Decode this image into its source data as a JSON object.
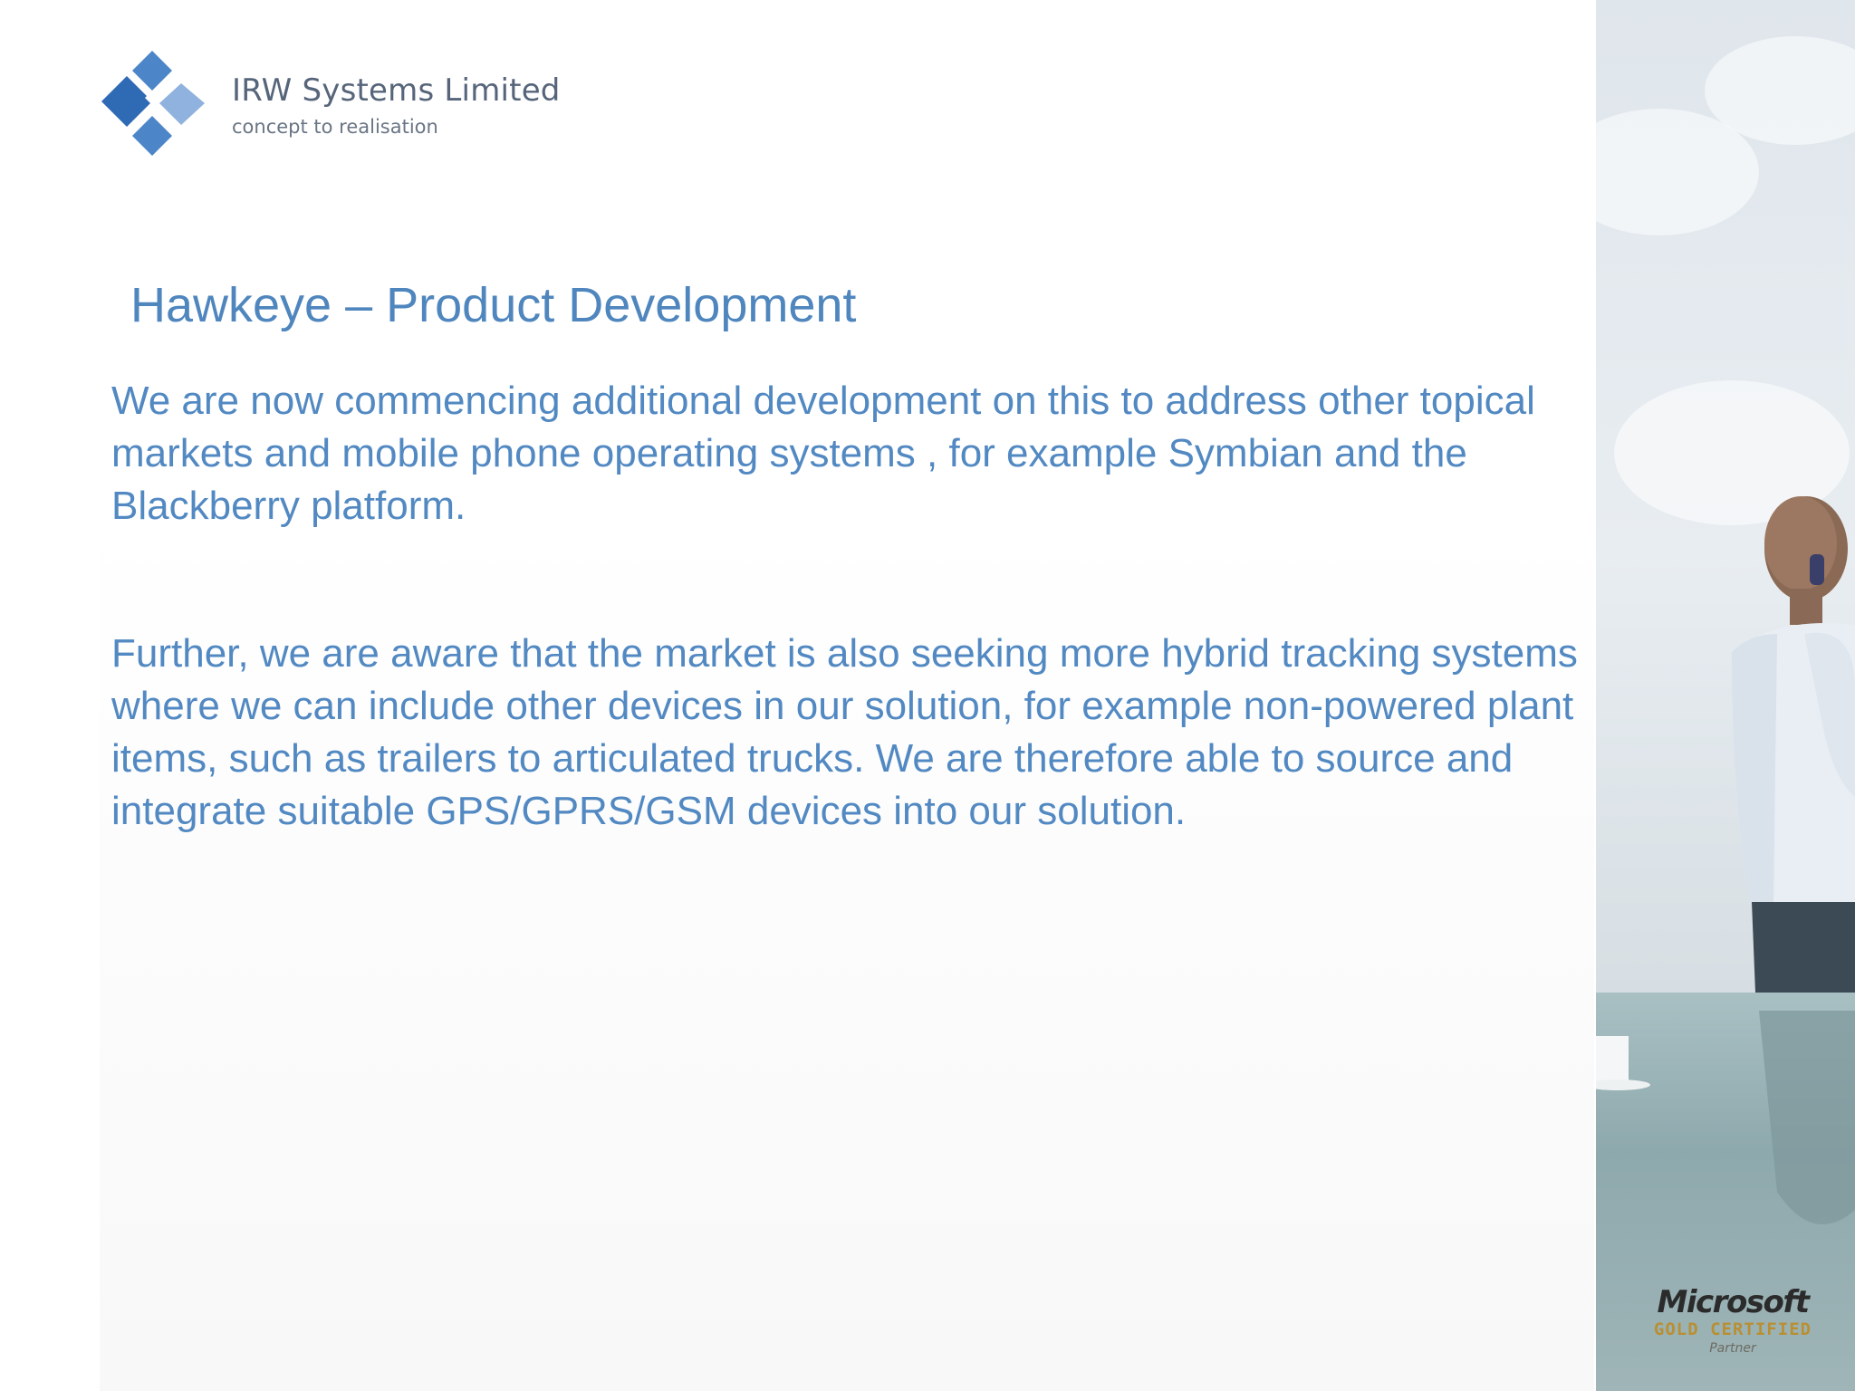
{
  "logo": {
    "company_name": "IRW Systems Limited",
    "tagline": "concept to realisation",
    "colors": {
      "dark_blue": "#2f6bb5",
      "mid_blue": "#4d86c8",
      "light_blue": "#8fb2de"
    }
  },
  "slide": {
    "title": "Hawkeye – Product Development",
    "paragraphs": [
      "We are now commencing additional development  on this to address other topical markets and mobile phone operating systems , for example Symbian and the Blackberry platform.",
      "Further, we are aware that the market is also seeking  more hybrid tracking systems where we can include other devices in our solution, for example non-powered plant items, such as trailers to articulated trucks. We  are therefore able to source and  integrate suitable GPS/GPRS/GSM devices into our solution."
    ],
    "text_color": "#5289c2"
  },
  "side_panel": {
    "badge": {
      "brand": "Microsoft",
      "certification": "GOLD CERTIFIED",
      "level": "Partner"
    }
  }
}
